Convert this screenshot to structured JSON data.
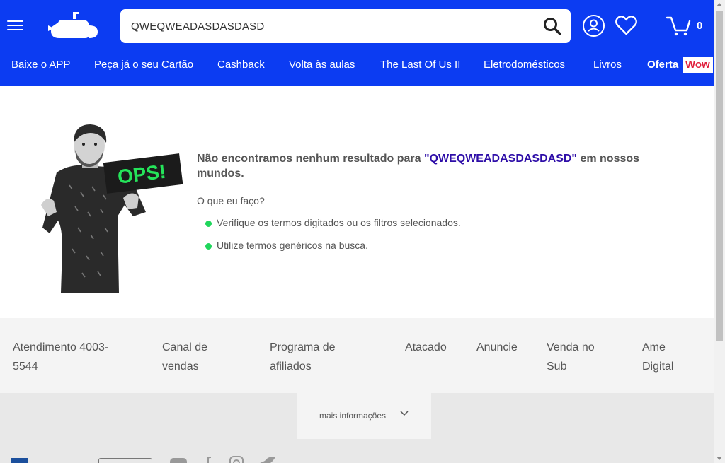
{
  "colors": {
    "header_bg": "#0c3cf2",
    "query": "#2e0ea8",
    "bullet": "#20d65c",
    "wow": "#e01f3c"
  },
  "header": {
    "menu_icon": "hamburger-menu-icon",
    "logo_icon": "submarine-logo-icon",
    "search": {
      "value": "QWEQWEADASDASDASD",
      "placeholder": ""
    },
    "search_icon": "search-icon",
    "user_icon": "user-icon",
    "wishlist_icon": "heart-icon",
    "cart_icon": "cart-icon",
    "cart_count": "0"
  },
  "nav": {
    "items": [
      "Baixe o APP",
      "Peça já o seu Cartão",
      "Cashback",
      "Volta às aulas",
      "The Last Of Us II",
      "Eletrodomésticos",
      "Livros",
      "Oferta"
    ],
    "badge": "Wow"
  },
  "main": {
    "hero_sign": "OPS!",
    "title_prefix": "Não encontramos nenhum resultado para ",
    "title_query": "\"QWEQWEADASDASDASD\"",
    "title_suffix": " em nossos mundos.",
    "subtitle": "O que eu faço?",
    "tips": [
      "Verifique os termos digitados ou os filtros selecionados.",
      "Utilize termos genéricos na busca."
    ]
  },
  "footer": {
    "links": [
      "Atendimento 4003-5544",
      "Canal de vendas",
      "Programa de afiliados",
      "Atacado",
      "Anuncie",
      "Venda no Sub",
      "Ame Digital"
    ],
    "more_info": "mais informações",
    "social_icons": [
      "youtube-icon",
      "facebook-icon",
      "instagram-icon",
      "twitter-icon"
    ]
  }
}
